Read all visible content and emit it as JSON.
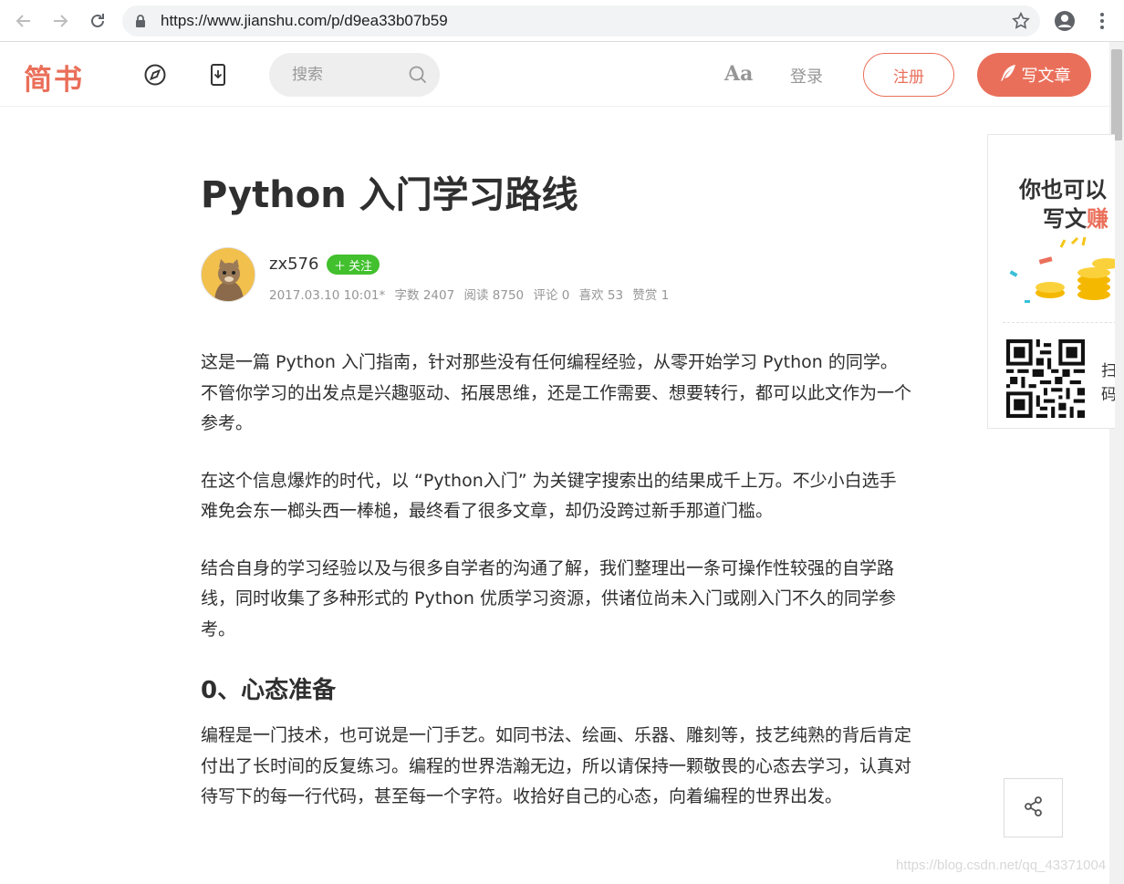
{
  "browser": {
    "url": "https://www.jianshu.com/p/d9ea33b07b59"
  },
  "header": {
    "logo": "简书",
    "search_placeholder": "搜索",
    "font_toggle": "Aa",
    "login": "登录",
    "register": "注册",
    "write": "写文章"
  },
  "article": {
    "title": "Python 入门学习路线",
    "author": {
      "name": "zx576",
      "follow": "关注",
      "meta": {
        "date": "2017.03.10 10:01*",
        "words": "字数 2407",
        "reads": "阅读 8750",
        "comments": "评论 0",
        "likes": "喜欢 53",
        "rewards": "赞赏 1"
      }
    },
    "paragraphs": [
      "这是一篇 Python 入门指南，针对那些没有任何编程经验，从零开始学习 Python 的同学。不管你学习的出发点是兴趣驱动、拓展思维，还是工作需要、想要转行，都可以此文作为一个参考。",
      "在这个信息爆炸的时代，以 “Python入门” 为关键字搜索出的结果成千上万。不少小白选手难免会东一榔头西一棒槌，最终看了很多文章，却仍没跨过新手那道门槛。",
      "结合自身的学习经验以及与很多自学者的沟通了解，我们整理出一条可操作性较强的自学路线，同时收集了多种形式的 Python 优质学习资源，供诸位尚未入门或刚入门不久的同学参考。"
    ],
    "heading_0": "0、心态准备",
    "paragraph_after_heading": "编程是一门技术，也可说是一门手艺。如同书法、绘画、乐器、雕刻等，技艺纯熟的背后肯定付出了长时间的反复练习。编程的世界浩瀚无边，所以请保持一颗敬畏的心态去学习，认真对待写下的每一行代码，甚至每一个字符。收拾好自己的心态，向着编程的世界出发。"
  },
  "ad": {
    "line1": "你也可以",
    "line2_prefix": "写文",
    "line2_highlight": "赚",
    "side_text": "扫码"
  },
  "watermark": "https://blog.csdn.net/qq_43371004",
  "colors": {
    "brand": "#ea6f5a",
    "follow": "#42c02e"
  }
}
